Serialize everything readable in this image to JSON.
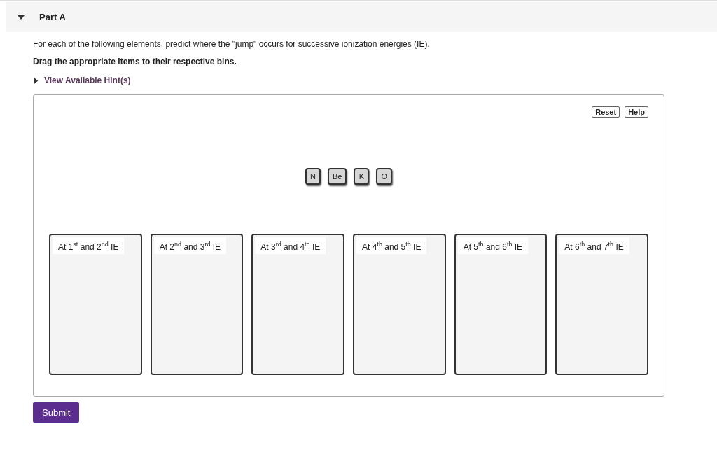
{
  "part": {
    "title": "Part A",
    "expanded": true
  },
  "instructions": "For each of the following elements, predict where the \"jump\" occurs for successive ionization energies (IE).",
  "task": "Drag the appropriate items to their respective bins.",
  "hint": {
    "label": "View Available Hint(s)",
    "expanded": false
  },
  "tools": [
    "Reset",
    "Help"
  ],
  "items": [
    "N",
    "Be",
    "K",
    "O"
  ],
  "bins": [
    {
      "label": "At 1$^{st}$ and 2$^{nd}$ IE"
    },
    {
      "label": "At 2$^{nd}$ and 3$^{rd}$ IE"
    },
    {
      "label": "At 3$^{rd}$ and 4$^{th}$ IE"
    },
    {
      "label": "At 4$^{th}$ and 5$^{th}$ IE"
    },
    {
      "label": "At 5$^{th}$ and 6$^{th}$ IE"
    },
    {
      "label": "At 6$^{th}$ and 7$^{th}$ IE"
    }
  ],
  "submit": "Submit"
}
